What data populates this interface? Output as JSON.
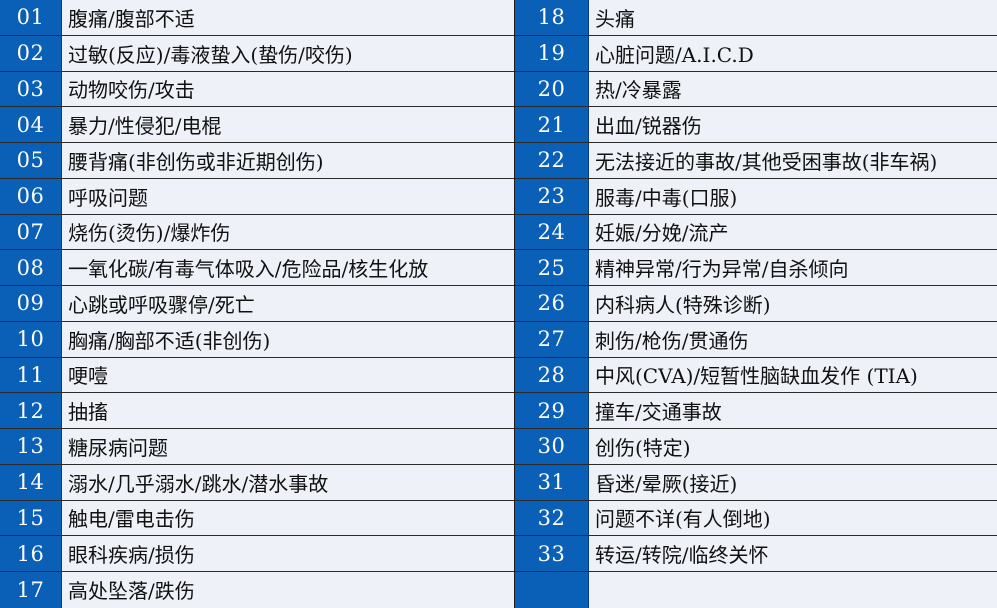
{
  "left_column": [
    {
      "num": "01",
      "label": "腹痛/腹部不适"
    },
    {
      "num": "02",
      "label": "过敏(反应)/毒液蛰入(蛰伤/咬伤)"
    },
    {
      "num": "03",
      "label": "动物咬伤/攻击"
    },
    {
      "num": "04",
      "label": "暴力/性侵犯/电棍"
    },
    {
      "num": "05",
      "label": "腰背痛(非创伤或非近期创伤)"
    },
    {
      "num": "06",
      "label": "呼吸问题"
    },
    {
      "num": "07",
      "label": "烧伤(烫伤)/爆炸伤"
    },
    {
      "num": "08",
      "label": "一氧化碳/有毒气体吸入/危险品/核生化放"
    },
    {
      "num": "09",
      "label": "心跳或呼吸骤停/死亡"
    },
    {
      "num": "10",
      "label": "胸痛/胸部不适(非创伤)"
    },
    {
      "num": "11",
      "label": "哽噎"
    },
    {
      "num": "12",
      "label": "抽搐"
    },
    {
      "num": "13",
      "label": "糖尿病问题"
    },
    {
      "num": "14",
      "label": "溺水/几乎溺水/跳水/潜水事故"
    },
    {
      "num": "15",
      "label": "触电/雷电击伤"
    },
    {
      "num": "16",
      "label": "眼科疾病/损伤"
    },
    {
      "num": "17",
      "label": "高处坠落/跌伤"
    }
  ],
  "right_column": [
    {
      "num": "18",
      "label": "头痛"
    },
    {
      "num": "19",
      "label": "心脏问题/A.I.C.D"
    },
    {
      "num": "20",
      "label": "热/冷暴露"
    },
    {
      "num": "21",
      "label": "出血/锐器伤"
    },
    {
      "num": "22",
      "label": "无法接近的事故/其他受困事故(非车祸)"
    },
    {
      "num": "23",
      "label": "服毒/中毒(口服)"
    },
    {
      "num": "24",
      "label": "妊娠/分娩/流产"
    },
    {
      "num": "25",
      "label": "精神异常/行为异常/自杀倾向"
    },
    {
      "num": "26",
      "label": "内科病人(特殊诊断)"
    },
    {
      "num": "27",
      "label": "刺伤/枪伤/贯通伤"
    },
    {
      "num": "28",
      "label": "中风(CVA)/短暂性脑缺血发作 (TIA)"
    },
    {
      "num": "29",
      "label": "撞车/交通事故"
    },
    {
      "num": "30",
      "label": "创伤(特定)"
    },
    {
      "num": "31",
      "label": "昏迷/晕厥(接近)"
    },
    {
      "num": "32",
      "label": "问题不详(有人倒地)"
    },
    {
      "num": "33",
      "label": "转运/转院/临终关怀"
    },
    {
      "num": "",
      "label": ""
    }
  ],
  "colors": {
    "number_cell_bg": "#0a5fb7",
    "label_cell_bg": "#eef1f8",
    "number_text": "#ffffff",
    "label_text": "#111111"
  }
}
